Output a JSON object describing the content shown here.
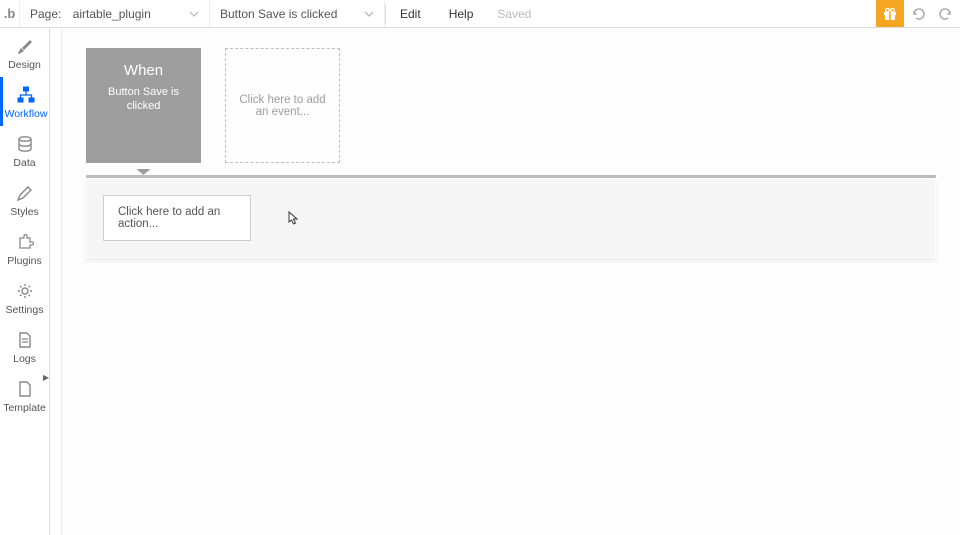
{
  "topbar": {
    "logo_text": ".b",
    "page_dropdown": {
      "prefix": "Page:",
      "value": "airtable_plugin"
    },
    "event_dropdown": {
      "value": "Button Save is clicked"
    },
    "edit_label": "Edit",
    "help_label": "Help",
    "saved_status": "Saved"
  },
  "sidebar": {
    "items": [
      {
        "label": "Design",
        "icon": "paintbrush-icon"
      },
      {
        "label": "Workflow",
        "icon": "sitemap-icon"
      },
      {
        "label": "Data",
        "icon": "database-icon"
      },
      {
        "label": "Styles",
        "icon": "pencil-icon"
      },
      {
        "label": "Plugins",
        "icon": "puzzle-icon"
      },
      {
        "label": "Settings",
        "icon": "gear-icon"
      },
      {
        "label": "Logs",
        "icon": "file-icon"
      },
      {
        "label": "Template",
        "icon": "template-icon"
      }
    ]
  },
  "workflow": {
    "selected_event": {
      "when_label": "When",
      "description": "Button Save is clicked"
    },
    "add_event_placeholder": "Click here to add an event...",
    "add_action_placeholder": "Click here to add an action..."
  }
}
